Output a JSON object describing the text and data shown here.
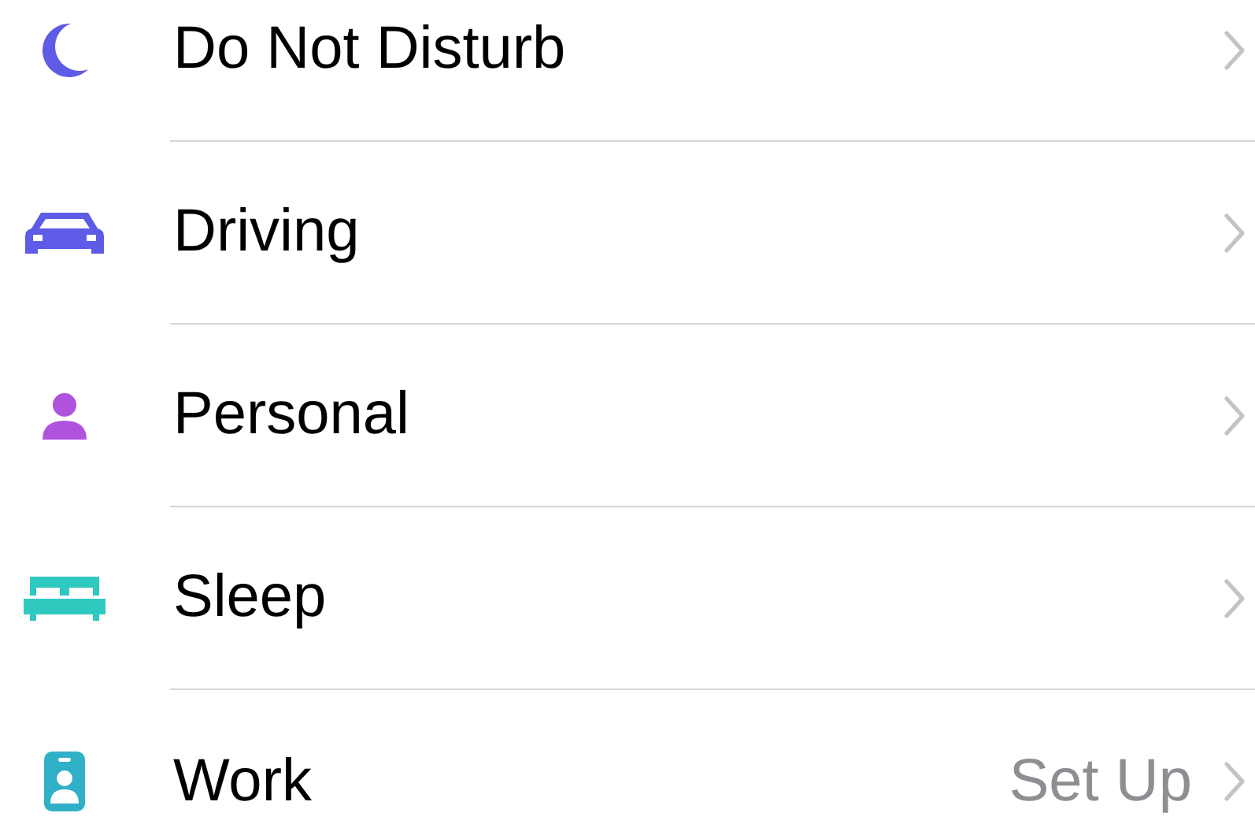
{
  "focus_modes": [
    {
      "label": "Do Not Disturb",
      "color": "#5e5ce6"
    },
    {
      "label": "Driving",
      "color": "#5e5ce6"
    },
    {
      "label": "Personal",
      "color": "#af52de"
    },
    {
      "label": "Sleep",
      "color": "#2fc9c0"
    },
    {
      "label": "Work",
      "color": "#30b0c7",
      "detail": "Set Up"
    }
  ]
}
